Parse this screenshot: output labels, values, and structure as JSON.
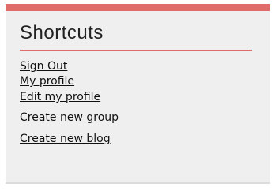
{
  "panel": {
    "title": "Shortcuts",
    "accent_color": "#e06b6b",
    "background_color": "#efefef",
    "links": [
      {
        "label": "Sign Out"
      },
      {
        "label": "My profile"
      },
      {
        "label": "Edit my profile"
      },
      {
        "label": "Create new group"
      },
      {
        "label": "Create new blog"
      }
    ]
  }
}
